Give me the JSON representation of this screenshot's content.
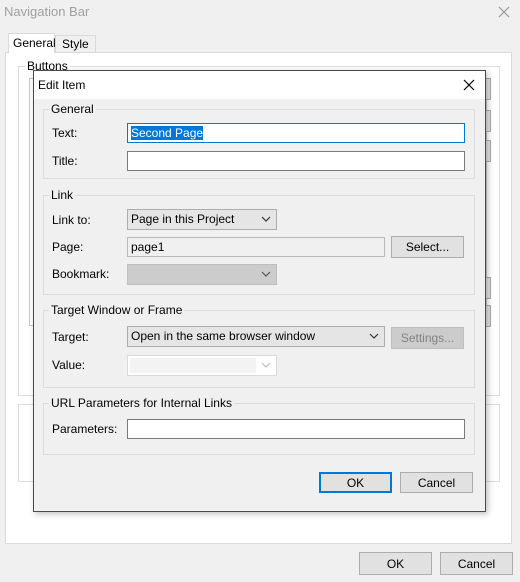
{
  "parent": {
    "title": "Navigation Bar",
    "tabs": [
      "General",
      "Style"
    ],
    "buttons_group": "Buttons",
    "ok_label": "OK",
    "cancel_label": "Cancel"
  },
  "dialog": {
    "title": "Edit Item",
    "general": {
      "legend": "General",
      "text_label": "Text:",
      "text_value": "Second Page",
      "title_label": "Title:",
      "title_value": ""
    },
    "link": {
      "legend": "Link",
      "link_to_label": "Link to:",
      "link_to_value": "Page in this Project",
      "page_label": "Page:",
      "page_value": "page1",
      "select_label": "Select...",
      "bookmark_label": "Bookmark:",
      "bookmark_value": ""
    },
    "target": {
      "legend": "Target Window or Frame",
      "target_label": "Target:",
      "target_value": "Open in the same browser window",
      "settings_label": "Settings...",
      "value_label": "Value:",
      "value_value": ""
    },
    "url": {
      "legend": "URL Parameters for Internal Links",
      "parameters_label": "Parameters:",
      "parameters_value": ""
    },
    "ok_label": "OK",
    "cancel_label": "Cancel"
  },
  "icons": {
    "close": "close-icon",
    "dropdown": "chevron-down-icon"
  }
}
